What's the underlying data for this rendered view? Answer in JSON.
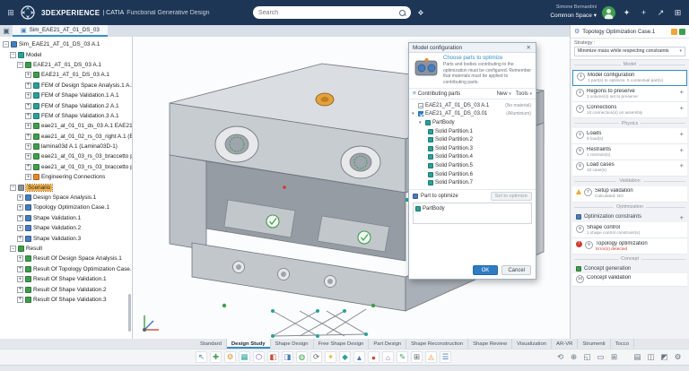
{
  "colors": {
    "brand-dark": "#1d3656",
    "accent": "#368ec4",
    "ok-blue": "#2e7cc3",
    "error-red": "#cf3b30",
    "warning-orange": "#eda63a",
    "success-green": "#3f9e4d",
    "select-orange": "#f6b14c"
  },
  "glyphs": {
    "plus": "+",
    "caret": "▾",
    "close": "✕",
    "menu": "≡",
    "gear": "⚙",
    "star": "✦",
    "share": "↗",
    "grid": "⊞",
    "tag": "❖",
    "cube": "▣",
    "exclam": "!",
    "appmenu": "⊞",
    "home": "▣"
  },
  "top_bar": {
    "brand": "3DEXPERIENCE",
    "app_prefix": "| CATIA",
    "app_name": "Functional Generative Design",
    "search_placeholder": "Search",
    "user_name": "Simone Bernardini",
    "space_label": "Common Space"
  },
  "tab_bar": {
    "tab": "Sim_EAE21_AT_01_DS_03"
  },
  "tree": {
    "root": "Sim_EAE21_AT_01_DS_03 A.1",
    "model_label": "Model",
    "assembly": "EAE21_AT_01_DS_03 A.1",
    "model_children": [
      "EAE21_AT_01_DS_03 A.1",
      "FEM of Design Space Analysis.1 A.1",
      "FEM of Shape Validation.1 A.1",
      "FEM of Shape Validation.2 A.1",
      "FEM of Shape Validation.3 A.1",
      "eae21_at_01_01_ds_03 A.1 EAE21_",
      "eae21_at_01_02_rs_03_right A.1 (EA",
      "lamina03d A.1 (Lamina03D-1)",
      "eae21_at_01_03_rs_03_braccetto pi",
      "eae21_at_01_03_rs_03_braccetto p",
      "Engineering Connections"
    ],
    "scenario_label": "Scenario",
    "scenario_children": [
      "Design Space Analysis.1",
      "Topology Optimization Case.1",
      "Shape Validation.1",
      "Shape Validation.2",
      "Shape Validation.3"
    ],
    "result_label": "Result",
    "result_children": [
      "Result Of Design Space Analysis.1",
      "Result Of Topology Optimization Case.",
      "Result Of Shape Validation.1",
      "Result Of Shape Validation.2",
      "Result Of Shape Validation.3"
    ]
  },
  "dialog": {
    "title": "Model configuration",
    "link": "Choose parts to optimize",
    "description": "Parts and bodies contributing to the optimization must be configured. Remember that materials must be applied to contributing parts.",
    "contributing_label": "Contributing parts",
    "menu_new": "New",
    "menu_tools": "Tools",
    "row1_label": "EAE21_AT_01_DS_03 A.1",
    "row1_note": "(No material)",
    "row2_label": "EAE21_AT_01_DS_03.01",
    "row2_note": "(Alluminium)",
    "partbody_label": "PartBody",
    "partitions": [
      "Solid Partition.1",
      "Solid Partition.2",
      "Solid Partition.3",
      "Solid Partition.4",
      "Solid Partition.5",
      "Solid Partition.6",
      "Solid Partition.7"
    ],
    "part_to_optimize_label": "Part to optimize",
    "set_button": "Set to optimize",
    "part_value": "PartBody",
    "ok": "OK",
    "cancel": "Cancel"
  },
  "assistant": {
    "title": "Topology Optimization Case.1",
    "strategy_label": "Strategy :",
    "strategy_value": "Minimize mass while respecting constraints",
    "sections": {
      "model": "Model",
      "physics": "Physics",
      "validation": "Validation",
      "optimization": "Optimization",
      "concept": "Concept"
    },
    "items": [
      {
        "num": "1",
        "label": "Model configuration",
        "detail": "1 part(s) to optimize, 5 contextual part(s)"
      },
      {
        "num": "2",
        "label": "Regions to preserve",
        "detail": "1 volume(s) set to preserve"
      },
      {
        "num": "3",
        "label": "Connections",
        "detail": "10 connection(s) on assembly"
      },
      {
        "num": "4",
        "label": "Loads",
        "detail": "9 load(s)"
      },
      {
        "num": "5",
        "label": "Restraints",
        "detail": "1 restraint(s)"
      },
      {
        "num": "6",
        "label": "Load cases",
        "detail": "10 case(s)"
      },
      {
        "num": "7",
        "label": "Setup validation",
        "detail": "Calculated: NO"
      },
      {
        "num": "8",
        "label": "Shape control",
        "detail": "1 shape control constraint(s)"
      },
      {
        "num": "9",
        "label": "Topology optimization",
        "detail": "Error(s) detected"
      },
      {
        "num": "10",
        "label": "Concept validation",
        "detail": ""
      }
    ],
    "optimization_constraints": "Optimization constraints",
    "concept_generation": "Concept generation"
  },
  "bottom": {
    "tabs": [
      "Standard",
      "Design Study",
      "Shape Design",
      "Free Shape Design",
      "Part Design",
      "Shape Reconstruction",
      "Shape Review",
      "Visualization",
      "AR-VR",
      "Strumenti",
      "Tocco"
    ],
    "active_tab": "Design Study",
    "icons": [
      {
        "g": "↖",
        "c": "#4a7dbd"
      },
      {
        "g": "✚",
        "c": "#3f9e4d"
      },
      {
        "g": "⚙",
        "c": "#e8872a"
      },
      {
        "g": "▦",
        "c": "#2aa198"
      },
      {
        "g": "⬡",
        "c": "#7a52a8"
      },
      {
        "g": "◧",
        "c": "#c94c3c"
      },
      {
        "g": "◨",
        "c": "#4a7dbd"
      },
      {
        "g": "◍",
        "c": "#3f9e4d"
      },
      {
        "g": "⟳",
        "c": "#5a646e"
      },
      {
        "g": "✦",
        "c": "#e8b82a"
      },
      {
        "g": "◆",
        "c": "#2aa198"
      },
      {
        "g": "▲",
        "c": "#4a7dbd"
      },
      {
        "g": "●",
        "c": "#c94c3c"
      },
      {
        "g": "⌂",
        "c": "#7a52a8"
      },
      {
        "g": "✎",
        "c": "#3f9e4d"
      },
      {
        "g": "⊞",
        "c": "#5a646e"
      },
      {
        "g": "◬",
        "c": "#e8872a"
      },
      {
        "g": "☰",
        "c": "#4a7dbd"
      }
    ],
    "view_icons": [
      {
        "g": "⟲",
        "c": "#6a7380"
      },
      {
        "g": "⊕",
        "c": "#6a7380"
      },
      {
        "g": "◱",
        "c": "#6a7380"
      },
      {
        "g": "▭",
        "c": "#6a7380"
      },
      {
        "g": "⊞",
        "c": "#6a7380"
      }
    ],
    "display_icons": [
      {
        "g": "▤",
        "c": "#6a7380"
      },
      {
        "g": "◫",
        "c": "#6a7380"
      },
      {
        "g": "◩",
        "c": "#6a7380"
      },
      {
        "g": "⚙",
        "c": "#6a7380"
      }
    ]
  }
}
